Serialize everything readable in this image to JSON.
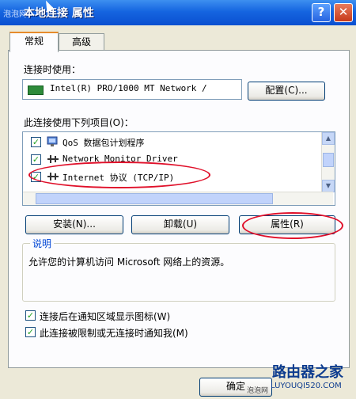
{
  "window": {
    "title": "本地连接 属性",
    "title_watermark": "泡泡网"
  },
  "titlebar_buttons": {
    "help": "?",
    "close": "✕"
  },
  "tabs": [
    {
      "label": "常规",
      "active": true
    },
    {
      "label": "高级",
      "active": false
    }
  ],
  "connect_using": {
    "label": "连接时使用：",
    "adapter": "Intel(R) PRO/1000 MT Network /",
    "configure_button": "配置(C)..."
  },
  "components": {
    "label": "此连接使用下列项目(O)：",
    "items": [
      {
        "label": "QoS 数据包计划程序",
        "checked": true,
        "icon": "qos-icon"
      },
      {
        "label": "Network Monitor Driver",
        "checked": true,
        "icon": "network-protocol-icon"
      },
      {
        "label": "Internet 协议 (TCP/IP)",
        "checked": true,
        "icon": "network-protocol-icon"
      }
    ],
    "scroll_up": "▲",
    "scroll_down": "▼"
  },
  "buttons": {
    "install": "安装(N)...",
    "uninstall": "卸载(U)",
    "properties": "属性(R)"
  },
  "description": {
    "group_label": "说明",
    "text": "允许您的计算机访问 Microsoft 网络上的资源。"
  },
  "options": [
    {
      "label": "连接后在通知区域显示图标(W)",
      "checked": true
    },
    {
      "label": "此连接被限制或无连接时通知我(M)",
      "checked": true
    }
  ],
  "footer": {
    "ok_button": "确定",
    "watermark_small": "泡泡网",
    "watermark_logo": "路由器之家",
    "watermark_url": "LUYOUQI520.COM"
  },
  "colors": {
    "highlight": "#e0102a",
    "titlebar": "#1565e0",
    "group_title": "#0046d5"
  }
}
